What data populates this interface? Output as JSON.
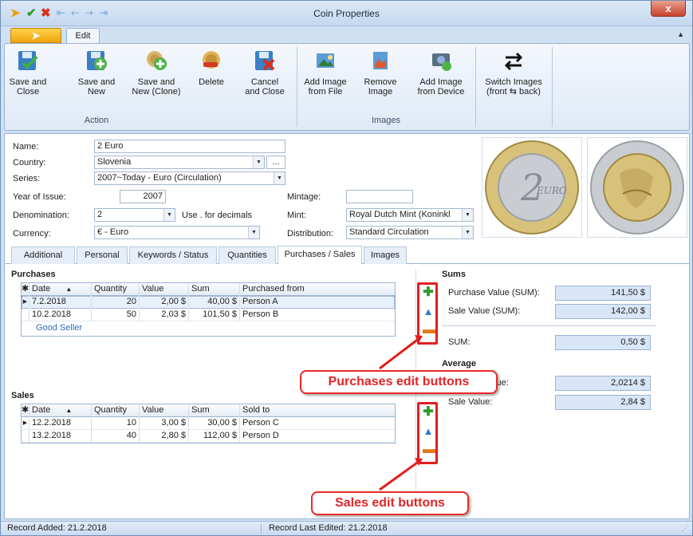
{
  "window": {
    "title": "Coin Properties",
    "close_symbol": "x"
  },
  "ribbon": {
    "tab_edit": "Edit",
    "buttons": {
      "save_close": [
        "Save and",
        "Close"
      ],
      "save_new": [
        "Save and",
        "New"
      ],
      "save_new_clone": [
        "Save and",
        "New (Clone)"
      ],
      "delete": "Delete",
      "cancel_close": [
        "Cancel",
        "and Close"
      ],
      "add_image_file": [
        "Add Image",
        "from File"
      ],
      "remove_image": [
        "Remove",
        "Image"
      ],
      "add_image_device": [
        "Add Image",
        "from Device"
      ],
      "switch_images": [
        "Switch Images",
        "(front ⇆ back)"
      ]
    },
    "groups": {
      "action": "Action",
      "images": "Images"
    }
  },
  "form": {
    "name_label": "Name:",
    "name_value": "2 Euro",
    "country_label": "Country:",
    "country_value": "Slovenia",
    "country_more": "...",
    "series_label": "Series:",
    "series_value": "2007~Today - Euro (Circulation)",
    "year_label": "Year of Issue:",
    "year_value": "2007",
    "denomination_label": "Denomination:",
    "denomination_value": "2",
    "decimals_hint": "Use . for decimals",
    "currency_label": "Currency:",
    "currency_value": "€ - Euro",
    "mintage_label": "Mintage:",
    "mintage_value": "",
    "mint_label": "Mint:",
    "mint_value": "Royal Dutch Mint (Koninkl",
    "distribution_label": "Distribution:",
    "distribution_value": "Standard Circulation"
  },
  "tabs": [
    "Additional",
    "Personal",
    "Keywords / Status",
    "Quantities",
    "Purchases / Sales",
    "Images"
  ],
  "purchases": {
    "title": "Purchases",
    "columns": [
      "Date",
      "Quantity",
      "Value",
      "Sum",
      "Purchased from"
    ],
    "rows": [
      [
        "7.2.2018",
        "20",
        "2,00 $",
        "40,00 $",
        "Person A"
      ],
      [
        "10.2.2018",
        "50",
        "2,03 $",
        "101,50 $",
        "Person B"
      ]
    ],
    "note": "Good Seller"
  },
  "sales": {
    "title": "Sales",
    "columns": [
      "Date",
      "Quantity",
      "Value",
      "Sum",
      "Sold to"
    ],
    "rows": [
      [
        "12.2.2018",
        "10",
        "3,00 $",
        "30,00 $",
        "Person C"
      ],
      [
        "13.2.2018",
        "40",
        "2,80 $",
        "112,00 $",
        "Person D"
      ]
    ]
  },
  "sums": {
    "title": "Sums",
    "purchase_label": "Purchase Value (SUM):",
    "purchase_value": "141,50 $",
    "sale_label": "Sale Value (SUM):",
    "sale_value": "142,00 $",
    "sum_label": "SUM:",
    "sum_value": "0,50 $"
  },
  "average": {
    "title": "Average",
    "purchase_label_visible": "alue:",
    "purchase_value": "2,0214 $",
    "sale_label": "Sale Value:",
    "sale_value": "2,84 $"
  },
  "callouts": {
    "purchases": "Purchases edit buttons",
    "sales": "Sales edit buttons"
  },
  "status": {
    "added": "Record Added: 21.2.2018",
    "edited": "Record Last Edited: 21.2.2018"
  },
  "colors": {
    "accent_red": "#e21f1f",
    "add_green": "#2f9a2f",
    "ribbon_blue": "#cfe0f3"
  }
}
